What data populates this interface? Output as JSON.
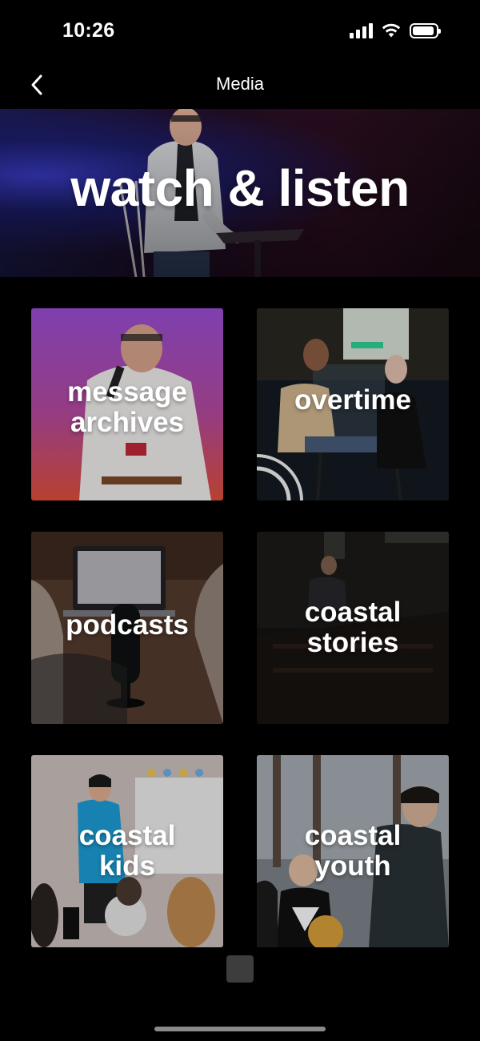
{
  "status_bar": {
    "time": "10:26",
    "icons": [
      "signal-icon",
      "wifi-icon",
      "battery-icon"
    ]
  },
  "nav": {
    "back_icon": "chevron-left-icon",
    "title": "Media"
  },
  "hero": {
    "title": "watch & listen"
  },
  "tiles": [
    {
      "id": "message-archives",
      "line1": "message",
      "line2": "archives"
    },
    {
      "id": "overtime",
      "line1": "overtime",
      "line2": ""
    },
    {
      "id": "podcasts",
      "line1": "podcasts",
      "line2": ""
    },
    {
      "id": "coastal-stories",
      "line1": "coastal",
      "line2": "stories"
    },
    {
      "id": "coastal-kids",
      "line1": "coastal",
      "line2": "kids"
    },
    {
      "id": "coastal-youth",
      "line1": "coastal",
      "line2": "youth"
    }
  ],
  "colors": {
    "background": "#000000",
    "text": "#ffffff",
    "hero_accent": "#3a3cc9",
    "archives_gradient_top": "#9b4fd6",
    "archives_gradient_bottom": "#e0503a"
  }
}
